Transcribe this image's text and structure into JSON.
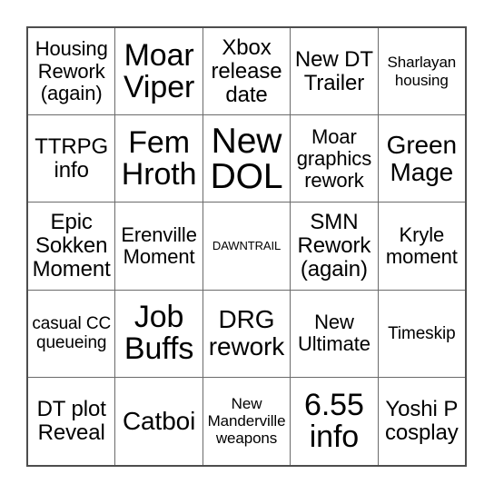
{
  "card": {
    "type": "bingo-card",
    "columns": 5,
    "rows": 5,
    "border_color": "#4d4d4d",
    "gridline_color": "#6b6b6b",
    "background_color": "#ffffff",
    "text_color": "#000000",
    "cells": [
      [
        {
          "text": "Housing Rework (again)",
          "size": "m"
        },
        {
          "text": "Moar Viper",
          "size": "xl"
        },
        {
          "text": "Xbox release date",
          "size": "ml"
        },
        {
          "text": "New DT Trailer",
          "size": "ml"
        },
        {
          "text": "Sharlayan housing",
          "size": "s"
        }
      ],
      [
        {
          "text": "TTRPG info",
          "size": "ml"
        },
        {
          "text": "Fem Hroth",
          "size": "xl"
        },
        {
          "text": "New DOL",
          "size": "xxl"
        },
        {
          "text": "Moar graphics rework",
          "size": "m"
        },
        {
          "text": "Green Mage",
          "size": "l"
        }
      ],
      [
        {
          "text": "Epic Sokken Moment",
          "size": "ml"
        },
        {
          "text": "Erenville Moment",
          "size": "m"
        },
        {
          "text": "DAWNTRAIL",
          "size": "xs"
        },
        {
          "text": "SMN Rework (again)",
          "size": "ml"
        },
        {
          "text": "Kryle moment",
          "size": "m"
        }
      ],
      [
        {
          "text": "casual CC queueing",
          "size": "sm"
        },
        {
          "text": "Job Buffs",
          "size": "xl"
        },
        {
          "text": "DRG rework",
          "size": "l"
        },
        {
          "text": "New Ultimate",
          "size": "m"
        },
        {
          "text": "Timeskip",
          "size": "sm"
        }
      ],
      [
        {
          "text": "DT plot Reveal",
          "size": "ml"
        },
        {
          "text": "Catboi",
          "size": "l"
        },
        {
          "text": "New Manderville weapons",
          "size": "s"
        },
        {
          "text": "6.55 info",
          "size": "xl"
        },
        {
          "text": "Yoshi P cosplay",
          "size": "ml"
        }
      ]
    ]
  }
}
